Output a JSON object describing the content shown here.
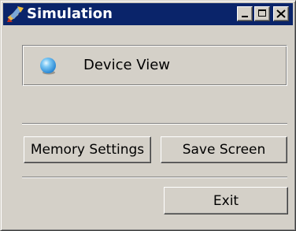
{
  "window": {
    "title": "Simulation",
    "app_icon": "tool-icon",
    "controls": [
      "minimize-icon",
      "maximize-icon",
      "close-icon"
    ]
  },
  "device_view": {
    "icon": "blue-sphere-icon",
    "label": "Device View"
  },
  "buttons": {
    "memory_settings": "Memory Settings",
    "save_screen": "Save Screen",
    "exit": "Exit"
  },
  "colors": {
    "titlebar": "#0a246a",
    "face": "#d4d0c8",
    "sphere": "#3aa0e8"
  }
}
